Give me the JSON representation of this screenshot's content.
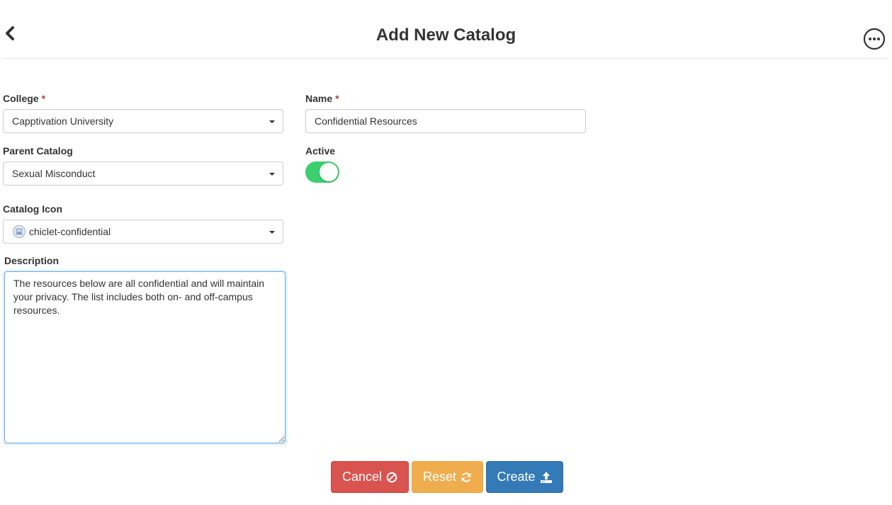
{
  "header": {
    "title": "Add New Catalog",
    "back_icon": "chevron-left-icon",
    "more_icon": "ellipsis-circle-icon"
  },
  "form": {
    "college": {
      "label": "College",
      "required_mark": "*",
      "value": "Capptivation University"
    },
    "name": {
      "label": "Name",
      "required_mark": "*",
      "value": "Confidential Resources"
    },
    "parent_catalog": {
      "label": "Parent Catalog",
      "value": "Sexual Misconduct"
    },
    "active": {
      "label": "Active",
      "checked": true,
      "on_color": "#3bcf6e"
    },
    "catalog_icon": {
      "label": "Catalog Icon",
      "value": "chiclet-confidential",
      "icon": "image-thumbnail-icon"
    },
    "description": {
      "label": "Description",
      "value": "The resources below are all confidential and will maintain your privacy. The list includes both on- and off-campus resources."
    }
  },
  "actions": {
    "cancel": {
      "label": "Cancel",
      "icon": "ban-icon",
      "color": "#d9534f"
    },
    "reset": {
      "label": "Reset",
      "icon": "refresh-icon",
      "color": "#f0ad4e"
    },
    "create": {
      "label": "Create",
      "icon": "upload-icon",
      "color": "#337ab7"
    }
  }
}
